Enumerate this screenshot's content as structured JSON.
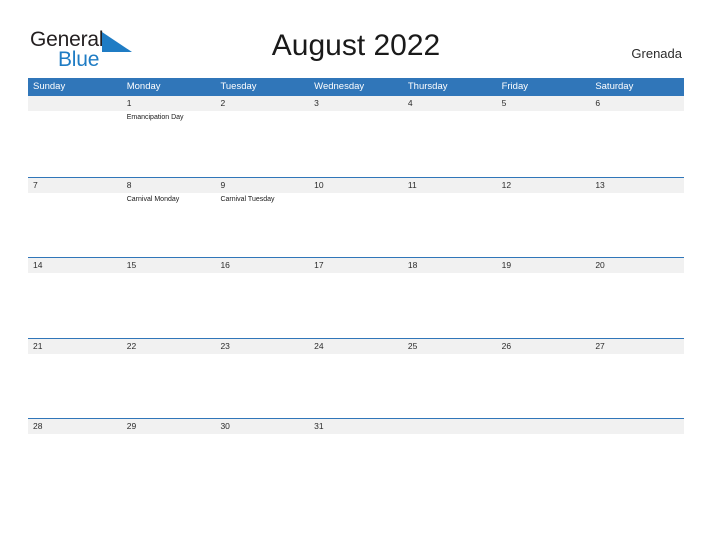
{
  "branding": {
    "name_part1": "General",
    "name_part2": "Blue",
    "flag_icon": "blue-triangle-flag-icon",
    "accent_color": "#1f7cc4"
  },
  "header": {
    "title": "August 2022",
    "country": "Grenada"
  },
  "colors": {
    "header_blue": "#3076b9",
    "band_gray": "#f1f1f1",
    "text_dark": "#2b2b2b"
  },
  "calendar": {
    "weekdays": [
      "Sunday",
      "Monday",
      "Tuesday",
      "Wednesday",
      "Thursday",
      "Friday",
      "Saturday"
    ],
    "weeks": [
      {
        "days": [
          {
            "num": "",
            "events": []
          },
          {
            "num": "1",
            "events": [
              "Emancipation Day"
            ]
          },
          {
            "num": "2",
            "events": []
          },
          {
            "num": "3",
            "events": []
          },
          {
            "num": "4",
            "events": []
          },
          {
            "num": "5",
            "events": []
          },
          {
            "num": "6",
            "events": []
          }
        ]
      },
      {
        "days": [
          {
            "num": "7",
            "events": []
          },
          {
            "num": "8",
            "events": [
              "Carnival Monday"
            ]
          },
          {
            "num": "9",
            "events": [
              "Carnival Tuesday"
            ]
          },
          {
            "num": "10",
            "events": []
          },
          {
            "num": "11",
            "events": []
          },
          {
            "num": "12",
            "events": []
          },
          {
            "num": "13",
            "events": []
          }
        ]
      },
      {
        "days": [
          {
            "num": "14",
            "events": []
          },
          {
            "num": "15",
            "events": []
          },
          {
            "num": "16",
            "events": []
          },
          {
            "num": "17",
            "events": []
          },
          {
            "num": "18",
            "events": []
          },
          {
            "num": "19",
            "events": []
          },
          {
            "num": "20",
            "events": []
          }
        ]
      },
      {
        "days": [
          {
            "num": "21",
            "events": []
          },
          {
            "num": "22",
            "events": []
          },
          {
            "num": "23",
            "events": []
          },
          {
            "num": "24",
            "events": []
          },
          {
            "num": "25",
            "events": []
          },
          {
            "num": "26",
            "events": []
          },
          {
            "num": "27",
            "events": []
          }
        ]
      },
      {
        "days": [
          {
            "num": "28",
            "events": []
          },
          {
            "num": "29",
            "events": []
          },
          {
            "num": "30",
            "events": []
          },
          {
            "num": "31",
            "events": []
          },
          {
            "num": "",
            "events": []
          },
          {
            "num": "",
            "events": []
          },
          {
            "num": "",
            "events": []
          }
        ]
      }
    ]
  }
}
